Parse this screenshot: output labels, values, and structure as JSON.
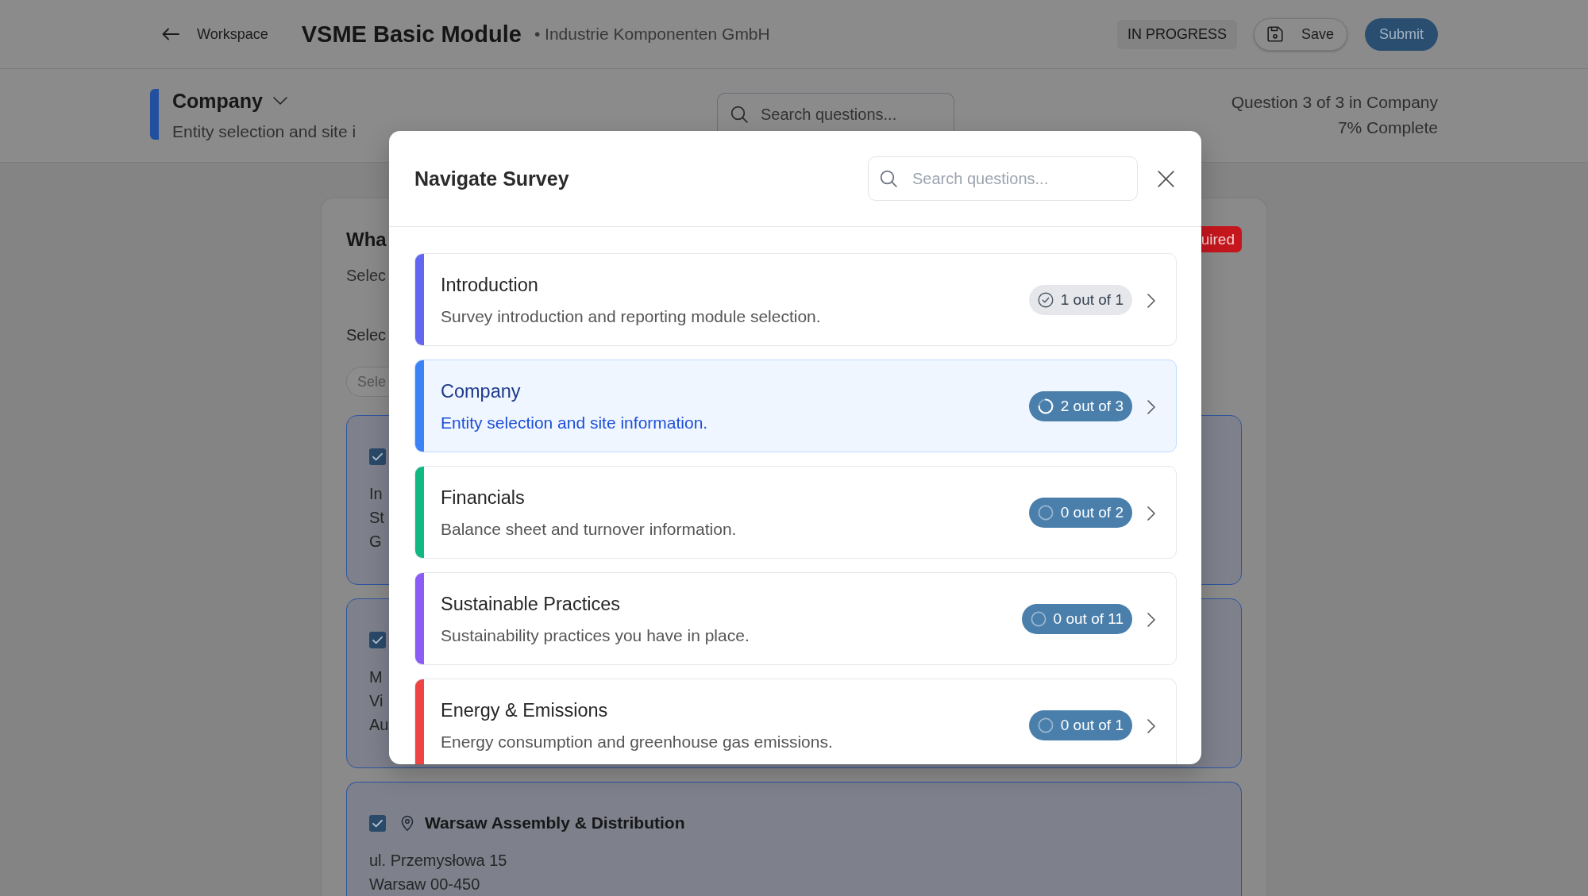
{
  "header": {
    "back_label": "Workspace",
    "title": "VSME Basic Module",
    "organization": "• Industrie Komponenten GmbH",
    "status": "IN PROGRESS",
    "save_label": "Save",
    "submit_label": "Submit"
  },
  "section_bar": {
    "title": "Company",
    "description": "Entity selection and site i",
    "search": {
      "placeholder": "Search questions..."
    },
    "position": "Question 3 of 3 in Company",
    "completion": "7% Complete"
  },
  "question": {
    "title": "Wha",
    "badge": "uired",
    "hint": "Selec",
    "field_label": "Selec",
    "select": {
      "placeholder": "Sele"
    },
    "sites": [
      {
        "checked": true,
        "lines": [
          "In",
          "St",
          "G"
        ]
      },
      {
        "checked": true,
        "lines": [
          "M",
          "Vi",
          "Au"
        ]
      },
      {
        "checked": true,
        "name": "Warsaw Assembly & Distribution",
        "lines": [
          "ul. Przemysłowa 15",
          "Warsaw 00-450"
        ]
      }
    ]
  },
  "modal": {
    "title": "Navigate Survey",
    "search": {
      "placeholder": "Search questions..."
    },
    "sections": [
      {
        "title": "Introduction",
        "description": "Survey introduction and reporting module selection.",
        "progress": "1 out of 1",
        "kind": "complete",
        "color": "#6366f1",
        "selected": false
      },
      {
        "title": "Company",
        "description": "Entity selection and site information.",
        "progress": "2 out of 3",
        "kind": "partial",
        "color": "#3b82f6",
        "selected": true
      },
      {
        "title": "Financials",
        "description": "Balance sheet and turnover information.",
        "progress": "0 out of 2",
        "kind": "pending",
        "color": "#10b981",
        "selected": false
      },
      {
        "title": "Sustainable Practices",
        "description": "Sustainability practices you have in place.",
        "progress": "0 out of 11",
        "kind": "pending",
        "color": "#8b5cf6",
        "selected": false
      },
      {
        "title": "Energy & Emissions",
        "description": "Energy consumption and greenhouse gas emissions.",
        "progress": "0 out of 1",
        "kind": "pending",
        "color": "#ef4444",
        "selected": false
      }
    ]
  }
}
